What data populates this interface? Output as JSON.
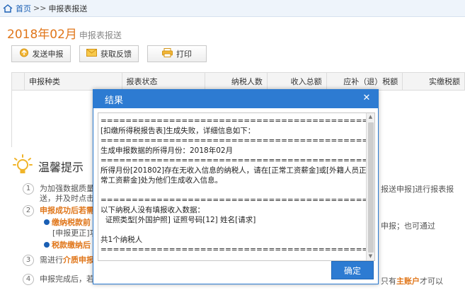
{
  "breadcrumb": {
    "home": "首页",
    "sep": ">>",
    "current": "申报表报送"
  },
  "page": {
    "period": "2018年02月",
    "subtitle": "申报表报送"
  },
  "toolbar": {
    "send": "发送申报",
    "feedback": "获取反馈",
    "print": "打印"
  },
  "table": {
    "headers": [
      "申报种类",
      "报表状态",
      "纳税人数",
      "收入总额",
      "应补（退）税额",
      "实缴税额"
    ]
  },
  "tips": {
    "title": "温馨提示",
    "items": [
      {
        "num": "1",
        "line1": "为加强数据质量控",
        "line2": "送，并及时点击[",
        "right1": "报送申报]进行报表报"
      },
      {
        "num": "2",
        "line1": "申报成功后若需",
        "sub1": "缴纳税款前",
        "sub1b": "[申报更正]功",
        "sub2": "税款缴纳后",
        "right": "申报；也可通过"
      },
      {
        "num": "3",
        "line1": "需进行",
        "line1b": "介质申报",
        "line1c": ""
      },
      {
        "num": "4",
        "line1": "申报完成后，若有",
        "right_a": "只有",
        "right_b": "主账户",
        "right_c": "才可以"
      }
    ]
  },
  "modal": {
    "title": "结果",
    "close": "✕",
    "message": "================================================================\n[扣缴所得税报告表]生成失败，详细信息如下：\n================================================================\n生成申报数据的所得月份：2018年02月\n================================================================\n所得月份[201802]存在无收入信息的纳税人，请在[正常工资薪金]或[外籍人员正常工资薪金]处为他们生成收入信息。\n\n================================================================\n以下纳税人没有填报收入数据：\n  证照类型[外国护照] 证照号码[12] 姓名[请求]\n\n共1个纳税人\n================================================================",
    "ok": "确定"
  }
}
